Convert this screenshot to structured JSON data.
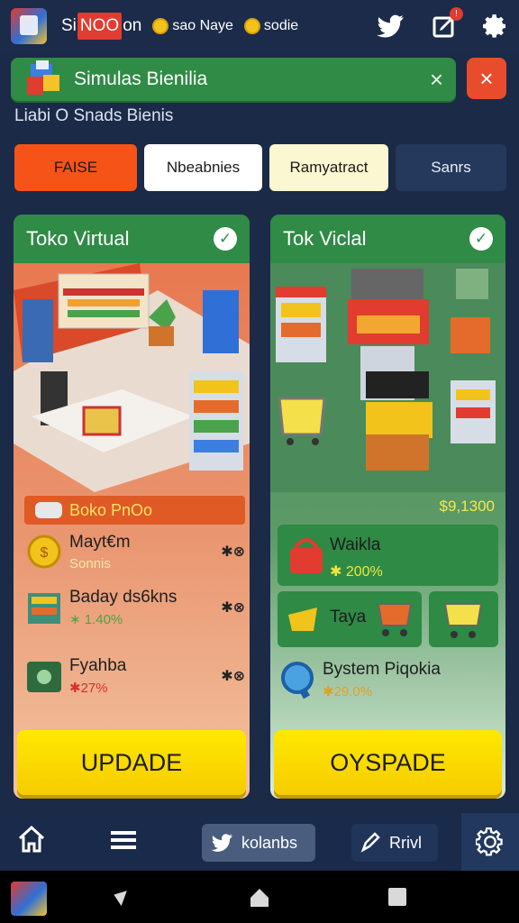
{
  "statusbar": {
    "title_parts": [
      "Si",
      "NOO",
      "on"
    ],
    "coin1_text": "sao Naye",
    "coin2_text": "sodie",
    "notification_badge": "!"
  },
  "banner": {
    "title": "Simulas Bienilia",
    "close_inline": "×",
    "close_button": "×"
  },
  "subtitle": "Liabi  O  Snads Bienis",
  "tabs": [
    "FAISE",
    "Nbeabnies",
    "Ramyatract",
    "Sanrs"
  ],
  "left_card": {
    "title": "Toko Virtual",
    "stat_label": "Boko PnOo",
    "items": [
      {
        "title": "Mayt€m",
        "sub": "Sonnis",
        "sub_color": "#f6e6a8",
        "mark": "✱⊗"
      },
      {
        "title": "Baday ds6kns",
        "sub": "∗ 1.40%",
        "sub_color": "#4aa34a",
        "mark": "✱⊗"
      },
      {
        "title": "Fyahba",
        "sub": "✱27%",
        "sub_color": "#d6312a",
        "mark": "✱⊗"
      }
    ],
    "button": "UPDADE"
  },
  "right_card": {
    "title": "Tok Viclal",
    "price": "$9,1300",
    "box1": {
      "title": "Waikla",
      "value": "✱ 200%"
    },
    "box2": {
      "title": "Taya"
    },
    "box3": {
      "title": "Bystem Piqokia",
      "value": "✱29.0%"
    },
    "button": "OYSPADE"
  },
  "bottom_nav": {
    "pill1": "kolanbs",
    "pill2": "Rrivl"
  },
  "colors": {
    "accent_green": "#2f8b45",
    "accent_orange": "#f65318",
    "button_yellow": "#ffe800",
    "bg_navy": "#1b2a47"
  }
}
